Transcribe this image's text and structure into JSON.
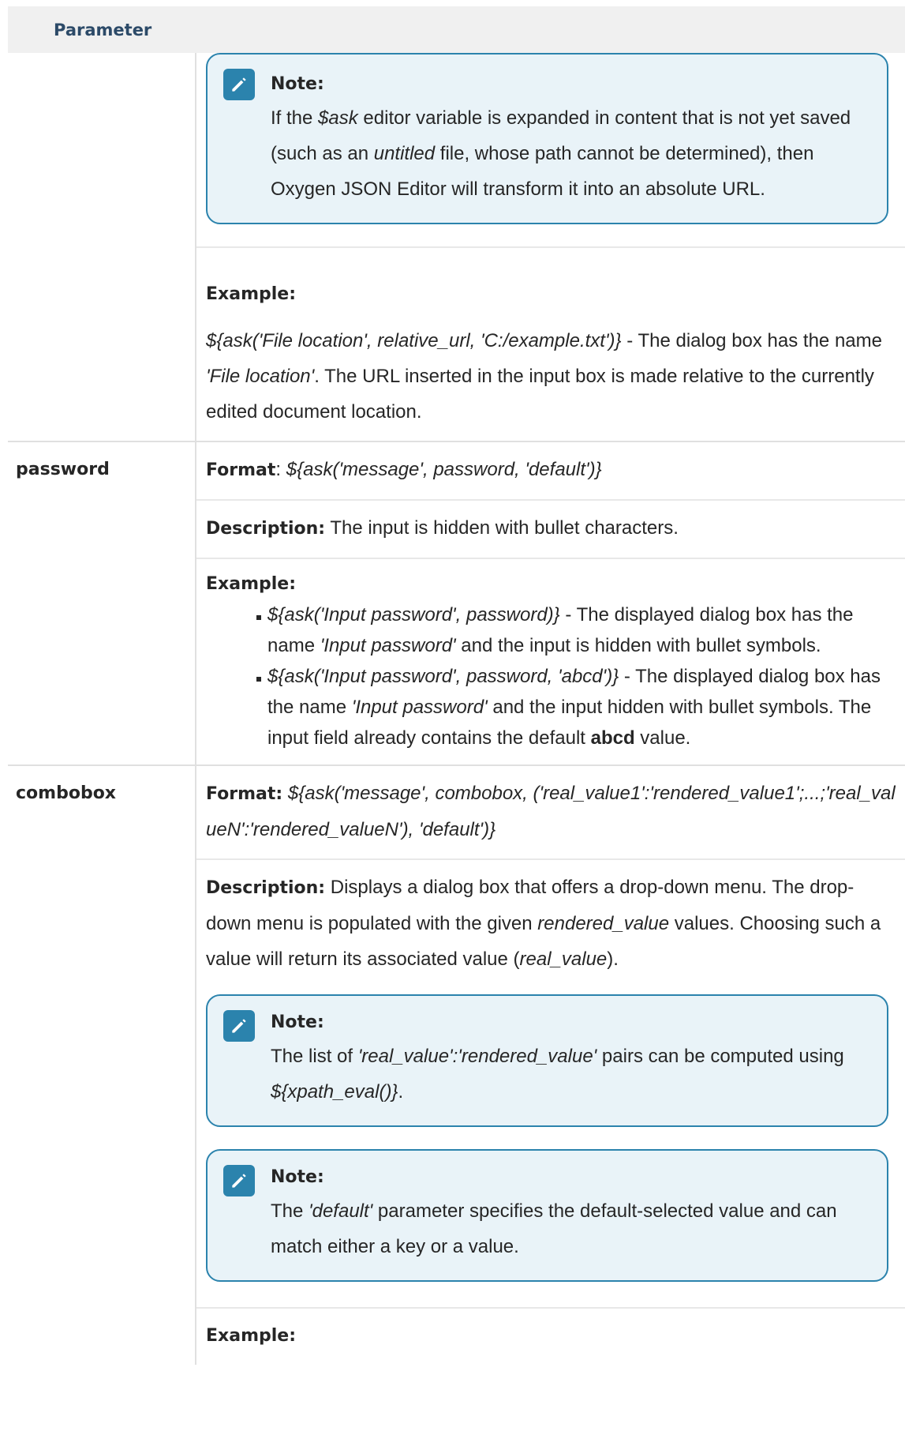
{
  "header": {
    "parameter": "Parameter"
  },
  "row_relative_url": {
    "note": {
      "title": "Note:",
      "t1": "If the ",
      "var": "$ask",
      "t2": " editor variable is expanded in content that is not yet saved (such as an ",
      "untitled": "untitled",
      "t3": " file, whose path cannot be determined), then Oxygen JSON Editor will transform it into an absolute URL."
    },
    "example": {
      "label": "Example:",
      "code": "${ask('File location', relative_url, 'C:/example.txt')}",
      "t1": " - The dialog box has the name ",
      "name": "'File location'",
      "t2": ". The URL inserted in the input box is made relative to the currently edited document location."
    }
  },
  "row_password": {
    "name": "password",
    "format_label": "Format",
    "format_sep": ": ",
    "format_code": "${ask('message', password, 'default')}",
    "desc_label": "Description:",
    "desc_text": " The input is hidden with bullet characters.",
    "example_label": "Example:",
    "examples": [
      {
        "code": "${ask('Input password', password)}",
        "t1": " - The displayed dialog box has the name ",
        "name": "'Input password'",
        "t2": " and the input is hidden with bullet symbols."
      },
      {
        "code": "${ask('Input password', password, 'abcd')}",
        "t1": " - The displayed dialog box has the name ",
        "name": "'Input password'",
        "t2": " and the input hidden with bullet symbols. The input field already contains the default ",
        "bold": "abcd",
        "t3": " value."
      }
    ]
  },
  "row_combobox": {
    "name": "combobox",
    "format_label": "Format:",
    "format_code": "${ask('message', combobox, ('real_value1':'rendered_value1';...;'real_valueN':'rendered_valueN'), 'default')}",
    "desc_label": "Description:",
    "desc_t1": " Displays a dialog box that offers a drop-down menu. The drop-down menu is populated with the given ",
    "desc_rv": "rendered_value",
    "desc_t2": " values. Choosing such a value will return its associated value (",
    "desc_real": "real_value",
    "desc_t3": ").",
    "note1": {
      "title": "Note:",
      "t1": "The list of ",
      "pairs": "'real_value':'rendered_value'",
      "t2": " pairs can be computed using ",
      "xpath": "${xpath_eval()}",
      "t3": "."
    },
    "note2": {
      "title": "Note:",
      "t1": "The ",
      "default": "'default'",
      "t2": " parameter specifies the default-selected value and can match either a key or a value."
    },
    "example_label": "Example:"
  },
  "colors": {
    "accent": "#2b83ad",
    "note_bg": "#e9f3f8",
    "header_bg": "#f0f0f0",
    "header_text": "#2c4a68"
  },
  "icons": {
    "note": "pencil-icon"
  }
}
